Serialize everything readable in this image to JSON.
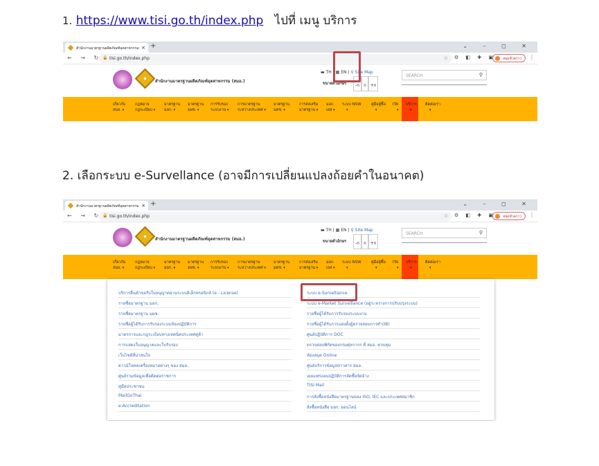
{
  "step1": {
    "num": "1.",
    "link": "https://www.tisi.go.th/index.php",
    "rest": "ไปที่ เมนู บริการ"
  },
  "step2": {
    "text": "2. เลือกระบบ e-Survellance (อาจมีการเปลี่ยนแปลงถ้อยคำในอนาคต)"
  },
  "browser": {
    "tab_title": "สำนักงานมาตรฐานผลิตภัณฑ์อุตสาหกรรม",
    "url": "tisi.go.th/index.php",
    "profile": "หยุดชั่วคราว"
  },
  "site": {
    "org_name": "สำนักงานมาตรฐานผลิตภัณฑ์อุตสาหกรรม (สมอ.)",
    "lang_th": "TH",
    "lang_en": "EN",
    "sitemap": "Site Map",
    "font_size_label": "ขนาดตัวอักษร",
    "font_small": "-ก",
    "font_normal": "ก",
    "font_large": "+ก",
    "search_placeholder": "SEARCH"
  },
  "nav": [
    {
      "l1": "เกี่ยวกับ",
      "l2": "สมอ."
    },
    {
      "l1": "กฎหมาย",
      "l2": "กฎระเบียบ"
    },
    {
      "l1": "มาตรฐาน",
      "l2": "มอก."
    },
    {
      "l1": "มาตรฐาน",
      "l2": "มผช."
    },
    {
      "l1": "การรับรอง",
      "l2": "ระบบงาน"
    },
    {
      "l1": "การมาตรฐาน",
      "l2": "ระหว่างประเทศ"
    },
    {
      "l1": "มาตรฐาน",
      "l2": "มตช."
    },
    {
      "l1": "การส่งเสริม",
      "l2": "มาตรฐาน"
    },
    {
      "l1": "มอก.",
      "l2": "เอส"
    },
    {
      "l1": "ระบบ NSW",
      "l2": ""
    },
    {
      "l1": "คู่มือผู้ซื้อ",
      "l2": ""
    },
    {
      "l1": "ITA",
      "l2": ""
    },
    {
      "l1": "บริการ",
      "l2": ""
    },
    {
      "l1": "ติดต่อเรา",
      "l2": ""
    }
  ],
  "dropdown": {
    "left": [
      "บริการยื่นคำขอรับใบอนุญาตผ่านระบบอิเล็กทรอนิกส์ (e - License)",
      "รายชื่อมาตรฐาน มอก.",
      "รายชื่อมาตรฐาน มผช.",
      "รายชื่อผู้ได้รับการรับรองระบบห้องปฏิบัติการ",
      "มาตรการและกฎระเบียบทางเทคนิคประเทศคู่ค้า",
      "การแสดงใบอนุญาตและใบรับรอง",
      "เว็บไซต์ที่น่าสนใจ",
      "ดาวน์โหลดเครื่องหมายต่างๆ ของ สมอ.",
      "ศูนย์รวมข้อมูลเพื่อติดต่อราชการ",
      "คู่มือประชาชน",
      "MailGoThai",
      "e-Accreditation"
    ],
    "right": [
      "ระบบ e-Survelliance",
      "ระบบ e-Market Surveillance (อยู่ระหว่างการปรับปรุงระบบ)",
      "รายชื่อผู้ได้รับการรับรองระบบงาน",
      "รายชื่อผู้ได้รับการแต่งตั้งผู้ตรวจสอบการทำ(IB)",
      "ศูนย์ปฏิบัติการ DOC",
      "ตรวจสอบพิกัดของกรมศุลกากร ที่ สมอ. ควบคุม",
      "ห้องสมุด Online",
      "ศูนย์บริการข้อมูลข่าวสาร สมอ.",
      "เผยแพร่แผนปฏิบัติการจัดซื้อจัดจ้าง",
      "TISI Mail",
      "การสั่งซื้อหนังสือมาตรฐานของ ISO, IEC และประเทศสมาชิก",
      "สั่งซื้อหนังสือ มอก. ออนไลน์"
    ]
  }
}
